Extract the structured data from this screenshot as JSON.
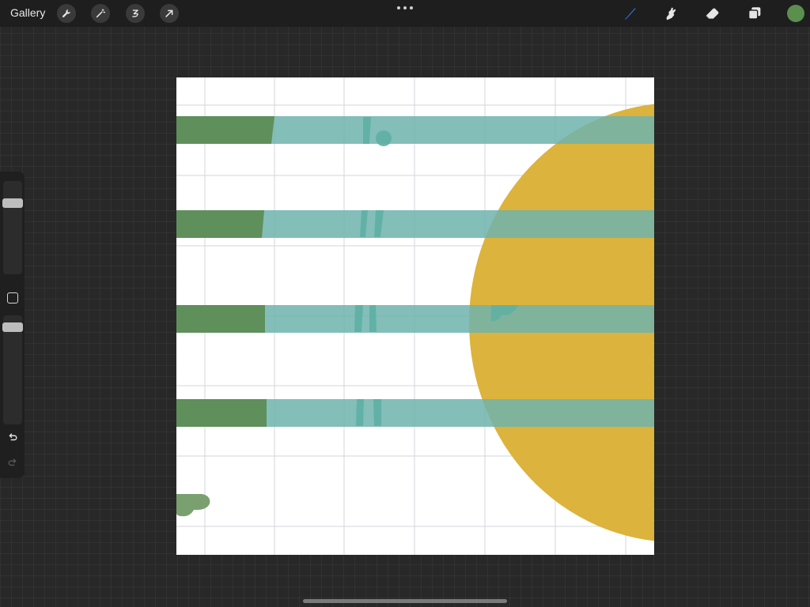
{
  "app": {
    "gallery_label": "Gallery"
  },
  "toolbar": {
    "left_tools": [
      {
        "name": "actions-icon"
      },
      {
        "name": "adjustments-icon"
      },
      {
        "name": "selection-icon"
      },
      {
        "name": "transform-icon"
      }
    ],
    "right_tools": [
      {
        "name": "brush-icon",
        "active": true
      },
      {
        "name": "smudge-icon",
        "active": false
      },
      {
        "name": "eraser-icon",
        "active": false
      },
      {
        "name": "layers-icon",
        "active": false
      }
    ],
    "current_color": "#5a8f4e"
  },
  "sidebar": {
    "brush_size_level": 0.85,
    "brush_opacity_level": 0.9
  },
  "colors": {
    "accent": "#2f7fff",
    "canvas_background": "#ffffff",
    "green_stripe": "#5f8f5b",
    "teal_stripe": "#7bbab5",
    "teal_mark": "#5fb0a4",
    "yellow_shape": "#dcb33c",
    "grid_line": "#c9cbd6"
  }
}
